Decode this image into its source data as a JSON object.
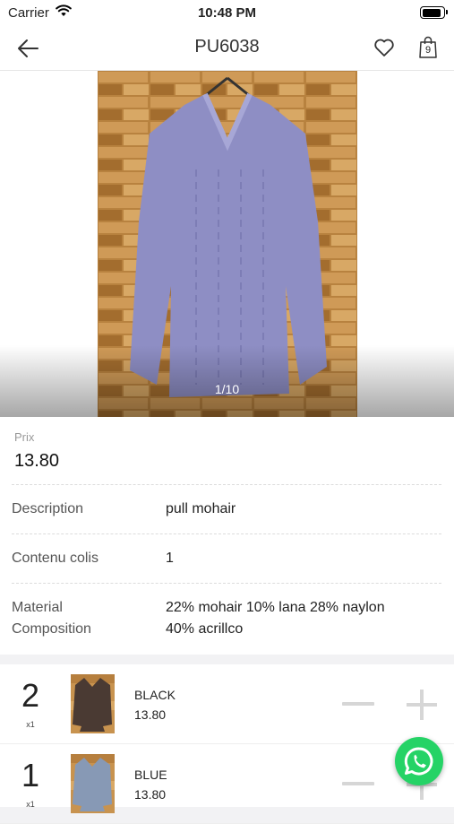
{
  "status_bar": {
    "carrier": "Carrier",
    "time": "10:48 PM"
  },
  "nav": {
    "title": "PU6038",
    "cart_count": "9"
  },
  "gallery": {
    "counter": "1/10"
  },
  "details": {
    "price_label": "Prix",
    "price_value": "13.80",
    "description_label": "Description",
    "description_value": "pull mohair",
    "package_label": "Contenu colis",
    "package_value": "1",
    "material_label_line1": "Material",
    "material_label_line2": "Composition",
    "material_value_line1": "22% mohair  10% lana  28% naylon",
    "material_value_line2": "40% acrillco"
  },
  "variants": [
    {
      "quantity": "2",
      "unit": "x1",
      "color": "BLACK",
      "price": "13.80"
    },
    {
      "quantity": "1",
      "unit": "x1",
      "color": "BLUE",
      "price": "13.80"
    }
  ],
  "colors": {
    "accent_whatsapp": "#25d366",
    "sweater": "#8e8ec4"
  }
}
